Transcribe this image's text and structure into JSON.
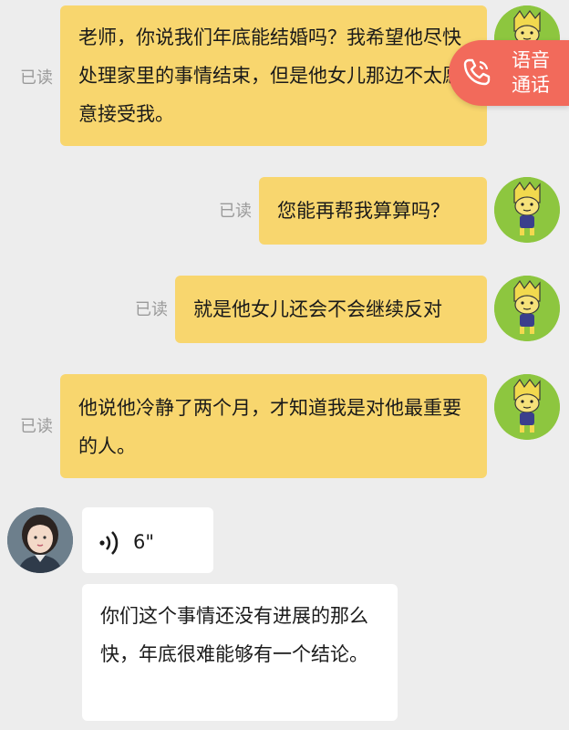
{
  "colors": {
    "background": "#ededed",
    "sent_bubble": "#f8d66e",
    "received_bubble": "#ffffff",
    "read_status": "#9a9a9a",
    "voice_call_button": "#f26a5b"
  },
  "voice_call": {
    "label_line1": "语音",
    "label_line2": "通话",
    "icon": "phone-icon"
  },
  "messages": [
    {
      "read": "已读",
      "text": "老师，你说我们年底能结婚吗？我希望他尽快处理家里的事情结束，但是他女儿那边不太愿意接受我。"
    },
    {
      "read": "已读",
      "text": "您能再帮我算算吗？"
    },
    {
      "read": "已读",
      "text": "就是他女儿还会不会继续反对"
    },
    {
      "read": "已读",
      "text": "他说他冷静了两个月，才知道我是对他最重要的人。"
    }
  ],
  "replies": {
    "voice_duration": "6\"",
    "voice_icon": "voice-wave-icon",
    "text": "你们这个事情还没有进展的那么快，年底很难能够有一个结论。"
  }
}
